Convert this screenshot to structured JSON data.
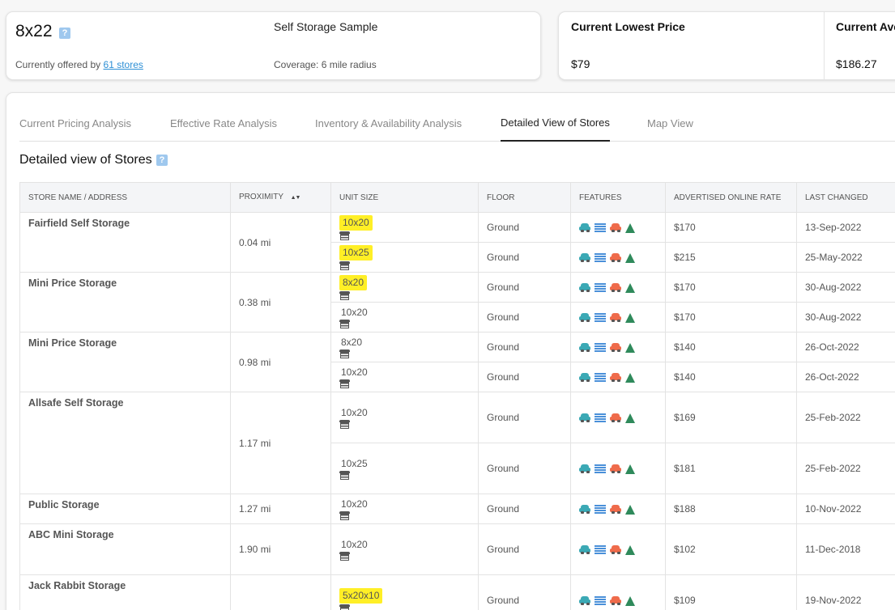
{
  "unit_card": {
    "title": "8x22",
    "help_glyph": "?",
    "offered_prefix": "Currently offered by",
    "stores_link": "61 stores",
    "sample_name": "Self Storage Sample",
    "coverage": "Coverage: 6 mile radius"
  },
  "price_card": {
    "lowest_label": "Current Lowest Price",
    "lowest_value": "$79",
    "average_label": "Current Ave",
    "average_value": "$186.27"
  },
  "tabs": [
    {
      "label": "Current Pricing Analysis"
    },
    {
      "label": "Effective Rate Analysis"
    },
    {
      "label": "Inventory & Availability Analysis"
    },
    {
      "label": "Detailed View of Stores"
    },
    {
      "label": "Map View"
    }
  ],
  "active_tab": "Detailed View of Stores",
  "section": {
    "title": "Detailed view of Stores",
    "help_glyph": "?"
  },
  "table": {
    "columns": [
      "STORE NAME / ADDRESS",
      "PROXIMITY",
      "UNIT SIZE",
      "FLOOR",
      "FEATURES",
      "ADVERTISED ONLINE RATE",
      "LAST CHANGED"
    ],
    "sort_glyph": "▲▼",
    "stores": [
      {
        "name": "Fairfield Self Storage",
        "proximity": "0.04 mi",
        "units": [
          {
            "size": "10x20",
            "highlight": true,
            "floor": "Ground",
            "rate": "$170",
            "changed": "13-Sep-2022"
          },
          {
            "size": "10x25",
            "highlight": true,
            "floor": "Ground",
            "rate": "$215",
            "changed": "25-May-2022"
          }
        ]
      },
      {
        "name": "Mini Price Storage",
        "proximity": "0.38 mi",
        "units": [
          {
            "size": "8x20",
            "highlight": true,
            "floor": "Ground",
            "rate": "$170",
            "changed": "30-Aug-2022"
          },
          {
            "size": "10x20",
            "highlight": false,
            "floor": "Ground",
            "rate": "$170",
            "changed": "30-Aug-2022"
          }
        ]
      },
      {
        "name": "Mini Price Storage",
        "proximity": "0.98 mi",
        "units": [
          {
            "size": "8x20",
            "highlight": false,
            "floor": "Ground",
            "rate": "$140",
            "changed": "26-Oct-2022"
          },
          {
            "size": "10x20",
            "highlight": false,
            "floor": "Ground",
            "rate": "$140",
            "changed": "26-Oct-2022"
          }
        ]
      },
      {
        "name": "Allsafe Self Storage",
        "proximity": "1.17 mi",
        "tall": true,
        "units": [
          {
            "size": "10x20",
            "highlight": false,
            "floor": "Ground",
            "rate": "$169",
            "changed": "25-Feb-2022"
          },
          {
            "size": "10x25",
            "highlight": false,
            "floor": "Ground",
            "rate": "$181",
            "changed": "25-Feb-2022"
          }
        ]
      },
      {
        "name": "Public Storage",
        "proximity": "1.27 mi",
        "units": [
          {
            "size": "10x20",
            "highlight": false,
            "floor": "Ground",
            "rate": "$188",
            "changed": "10-Nov-2022"
          }
        ]
      },
      {
        "name": "ABC Mini Storage",
        "proximity": "1.90 mi",
        "tall": true,
        "units": [
          {
            "size": "10x20",
            "highlight": false,
            "floor": "Ground",
            "rate": "$102",
            "changed": "11-Dec-2018"
          }
        ]
      },
      {
        "name": "Jack Rabbit Storage",
        "proximity": "",
        "tall": true,
        "units": [
          {
            "size": "5x20x10",
            "highlight": true,
            "floor": "Ground",
            "rate": "$109",
            "changed": "19-Nov-2022"
          }
        ]
      }
    ],
    "feature_icons": [
      "car-icon-teal",
      "lines-icon-blue",
      "car-icon-orange",
      "tree-icon-green"
    ]
  },
  "colors": {
    "highlight": "#ffef26",
    "link": "#2d8fd5",
    "teal": "#3ba9b5",
    "orange": "#ef6b4b",
    "blue": "#4a90d9",
    "green": "#2f8a5b"
  }
}
